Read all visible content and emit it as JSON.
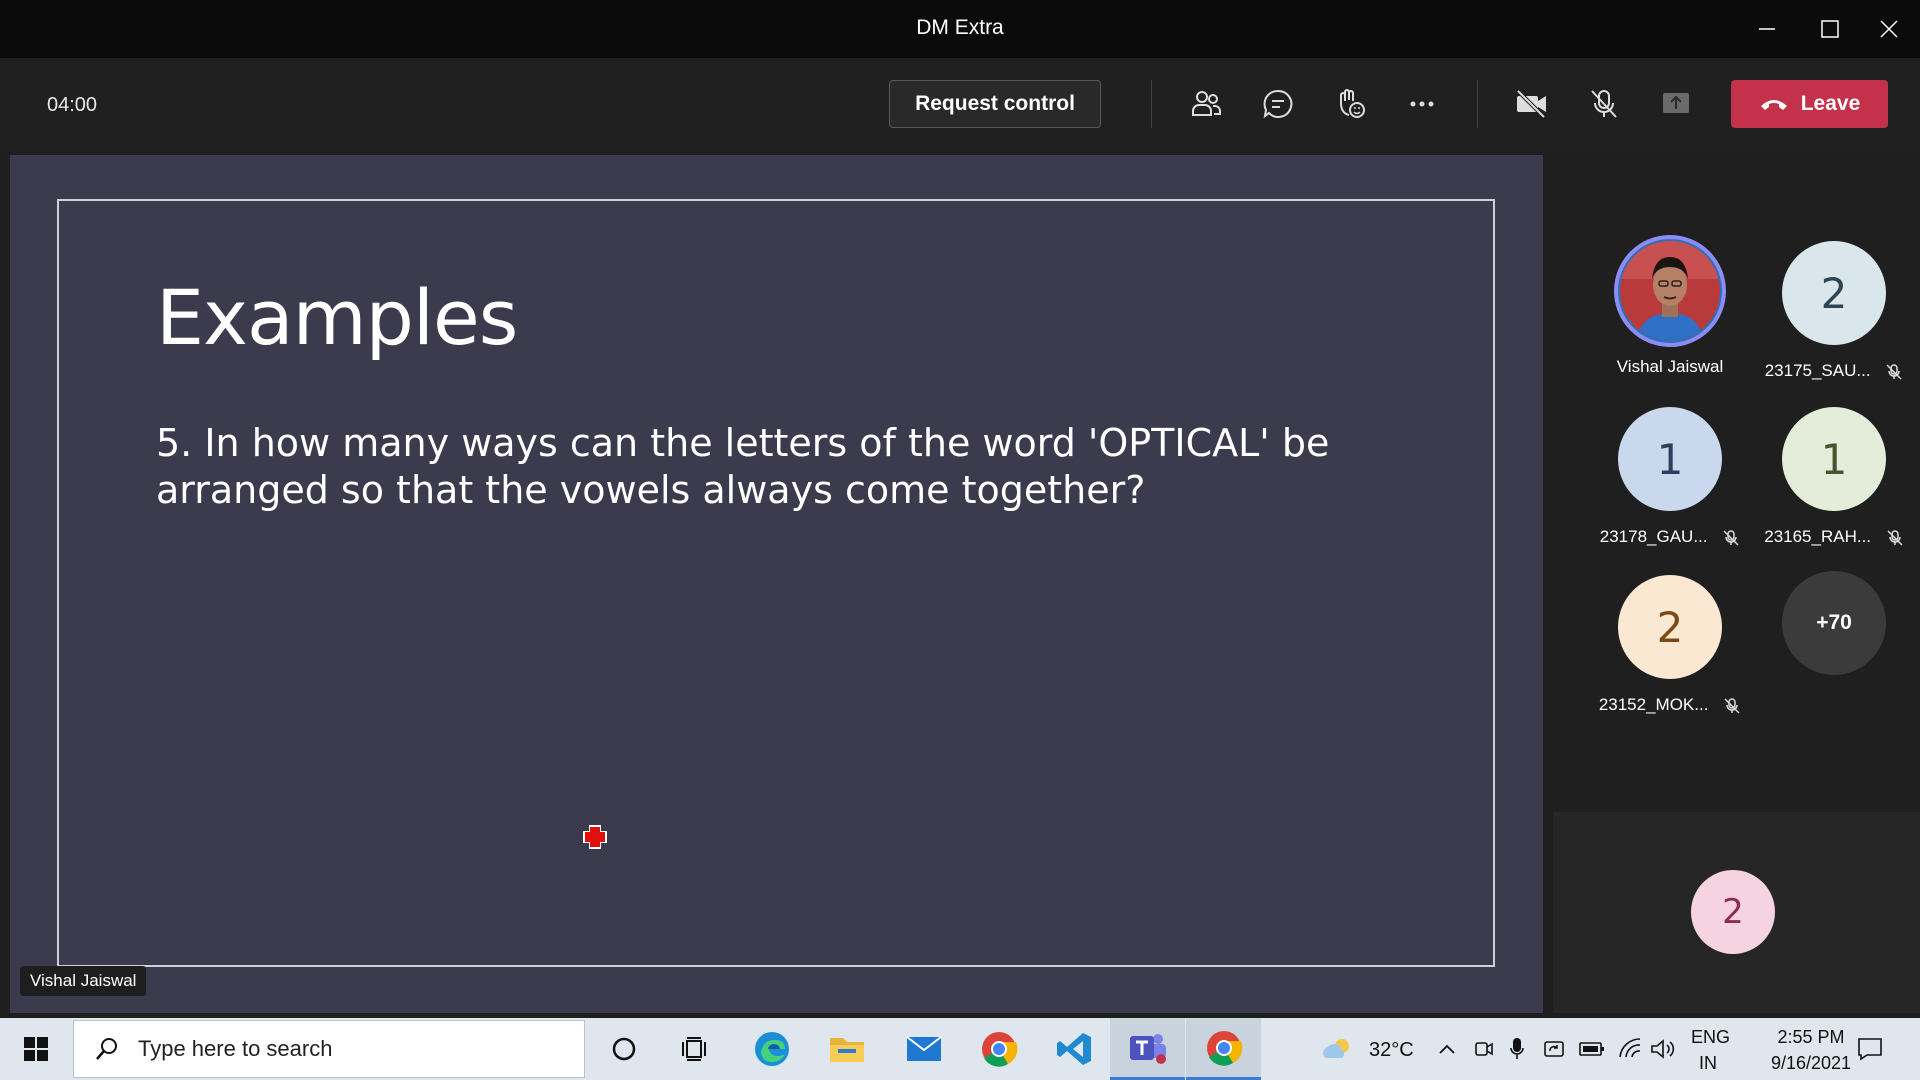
{
  "window": {
    "title": "DM Extra"
  },
  "toolbar": {
    "timer": "04:00",
    "request_control_label": "Request control",
    "leave_label": "Leave"
  },
  "slide": {
    "title": "Examples",
    "body": "5. In how many ways can the letters of the word 'OPTICAL' be arranged so that the vowels always come together?"
  },
  "presenter_label": "Vishal Jaiswal",
  "participants": [
    {
      "name": "Vishal Jaiswal",
      "initial": "",
      "muted": false,
      "bg": "#2f6db5",
      "fg": "#ffffff"
    },
    {
      "name": "23175_SAU...",
      "initial": "2",
      "muted": true,
      "bg": "#d9e6ec",
      "fg": "#2e4553"
    },
    {
      "name": "23178_GAU...",
      "initial": "1",
      "muted": true,
      "bg": "#c9d8ec",
      "fg": "#2d3f5c"
    },
    {
      "name": "23165_RAH...",
      "initial": "1",
      "muted": true,
      "bg": "#e4edd9",
      "fg": "#45552e"
    },
    {
      "name": "23152_MOK...",
      "initial": "2",
      "muted": true,
      "bg": "#fbe8d3",
      "fg": "#7b4a17"
    }
  ],
  "overflow_count": "+70",
  "overflow_avatar": {
    "initial": "2",
    "bg": "#f6d3e0",
    "fg": "#8a2b50"
  },
  "taskbar": {
    "search_placeholder": "Type here to search",
    "weather": "32°C",
    "lang_line1": "ENG",
    "lang_line2": "IN",
    "time": "2:55 PM",
    "date": "9/16/2021"
  },
  "colors": {
    "leave": "#c4314b",
    "stage": "#3c3a4d",
    "presenter_ring": "#8b8cf5"
  }
}
